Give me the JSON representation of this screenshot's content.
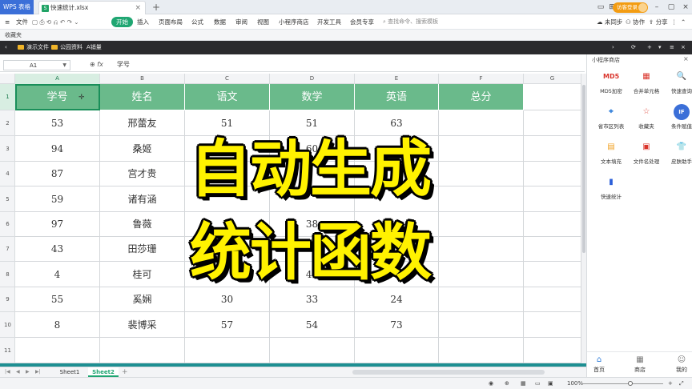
{
  "titlebar": {
    "app_name": "WPS 表格",
    "doc_tab": "快速统计.xlsx",
    "login_label": "访客登录"
  },
  "menubar": {
    "file": "文件",
    "tabs": [
      "开始",
      "插入",
      "页面布局",
      "公式",
      "数据",
      "审阅",
      "视图",
      "小程序商店",
      "开发工具",
      "会员专享"
    ],
    "search_placeholder": "查找命令、搜索模板",
    "sync": "未同步",
    "collab": "协作",
    "share": "分享"
  },
  "favbar": {
    "label": "收藏夹"
  },
  "darkbar": {
    "items": [
      "演示文件",
      "公园资料",
      "A销量"
    ]
  },
  "formula": {
    "cell_ref": "A1",
    "fx": "fx",
    "value": "学号"
  },
  "columns": [
    "A",
    "B",
    "C",
    "D",
    "E",
    "F",
    "G"
  ],
  "rows": [
    "1",
    "2",
    "3",
    "4",
    "5",
    "6",
    "7",
    "8",
    "9",
    "10",
    "11"
  ],
  "table": {
    "headers": [
      "学号",
      "姓名",
      "语文",
      "数学",
      "英语",
      "总分"
    ],
    "data": [
      [
        "53",
        "邢蕾友",
        "51",
        "51",
        "63",
        ""
      ],
      [
        "94",
        "桑姬",
        "",
        "60",
        "",
        ""
      ],
      [
        "87",
        "宫才贵",
        "",
        "",
        "",
        ""
      ],
      [
        "59",
        "诸有涵",
        "",
        "",
        "",
        ""
      ],
      [
        "97",
        "鲁薇",
        "",
        "38",
        "",
        ""
      ],
      [
        "43",
        "田莎珊",
        "",
        "",
        "",
        ""
      ],
      [
        "4",
        "桂可",
        "",
        "44",
        "",
        ""
      ],
      [
        "55",
        "奚娴",
        "30",
        "33",
        "24",
        ""
      ],
      [
        "8",
        "裴博采",
        "57",
        "54",
        "73",
        ""
      ]
    ]
  },
  "overlay": {
    "line1": "自动生成",
    "line2": "统计函数"
  },
  "sheets": [
    "Sheet1",
    "Sheet2"
  ],
  "status": {
    "zoom": "100%"
  },
  "panel": {
    "title": "小程序商店",
    "items": [
      {
        "label": "MD5加密",
        "icon": "md5-icon",
        "glyph": "MD5",
        "color": "#d9342b"
      },
      {
        "label": "合并单元格",
        "icon": "merge-cells-icon",
        "glyph": "▦",
        "color": "#d9342b"
      },
      {
        "label": "快速查询",
        "icon": "search-icon",
        "glyph": "🔍",
        "color": "#1fa672"
      },
      {
        "label": "省市区列表",
        "icon": "location-icon",
        "glyph": "⌖",
        "color": "#2b7bd9"
      },
      {
        "label": "收藏夹",
        "icon": "star-icon",
        "glyph": "☆",
        "color": "#e05a4f"
      },
      {
        "label": "条件赋值",
        "icon": "if-icon",
        "glyph": "IF",
        "color": "#3b6fd8"
      },
      {
        "label": "文本填充",
        "icon": "text-fill-icon",
        "glyph": "▤",
        "color": "#f0a020"
      },
      {
        "label": "文件名处理",
        "icon": "filename-icon",
        "glyph": "▣",
        "color": "#d9342b"
      },
      {
        "label": "皮肤助手",
        "icon": "shirt-icon",
        "glyph": "👕",
        "color": "#d9342b"
      },
      {
        "label": "快速统计",
        "icon": "bar-chart-icon",
        "glyph": "▮",
        "color": "#2b5fd9"
      }
    ],
    "nav": [
      "首页",
      "商店",
      "我的"
    ]
  }
}
